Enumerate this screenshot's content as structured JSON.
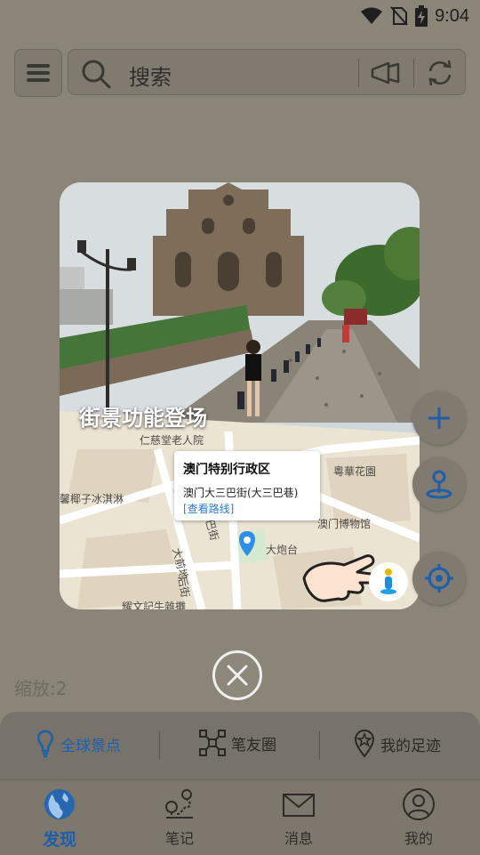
{
  "status": {
    "time": "9:04",
    "icons": [
      "wifi-icon",
      "no-sim-icon",
      "battery-charging-icon"
    ]
  },
  "search": {
    "placeholder": "搜索",
    "icons": [
      "menu-icon",
      "search-icon",
      "horn-icon",
      "refresh-icon"
    ]
  },
  "promo": {
    "title": "街景功能登场",
    "map_labels": {
      "elderly_home": "仁慈堂老人院",
      "icecream": "馨椰子冰淇淋",
      "garden": "粵華花園",
      "museum": "澳门博物馆",
      "fortress": "大炮台",
      "road1": "大前地",
      "road2": "后街",
      "road3": "巴街",
      "bottom": "耀文記牛雜攤"
    },
    "card": {
      "title": "澳门特别行政区",
      "address": "澳门大三巴街(大三巴巷)",
      "route_link": "[查看路线]"
    }
  },
  "map": {
    "zoom_label": "缩放:2",
    "side_buttons": [
      "add-icon",
      "pin-icon",
      "locate-icon"
    ]
  },
  "tabs": [
    {
      "label": "全球景点",
      "icon": "lightbulb-pin-icon",
      "active": true
    },
    {
      "label": "笔友圈",
      "icon": "network-icon",
      "active": false
    },
    {
      "label": "我的足迹",
      "icon": "star-pin-icon",
      "active": false
    }
  ],
  "bottom_nav": [
    {
      "label": "发现",
      "icon": "globe-icon",
      "active": true
    },
    {
      "label": "笔记",
      "icon": "route-pin-icon",
      "active": false
    },
    {
      "label": "消息",
      "icon": "mail-icon",
      "active": false
    },
    {
      "label": "我的",
      "icon": "user-icon",
      "active": false
    }
  ],
  "colors": {
    "accent": "#1e5fa8",
    "overlay": "#8b8579"
  }
}
